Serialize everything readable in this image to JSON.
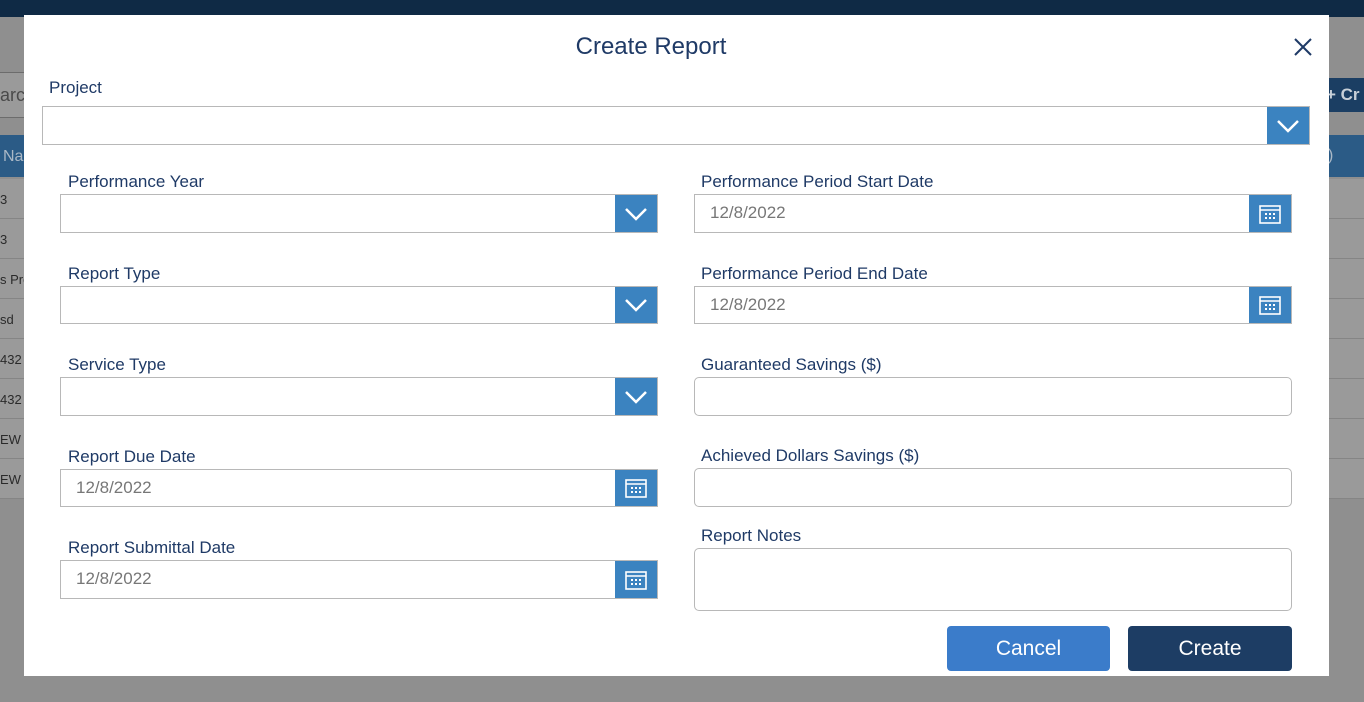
{
  "background": {
    "search_fragment": "arch",
    "create_fragment": "+ Cr",
    "header_left_fragment": "Na",
    "header_right_fragment": ")",
    "row_fragments": [
      "3",
      "3",
      "s Pro",
      "sd",
      "432",
      "432",
      "EW",
      "EW"
    ]
  },
  "modal": {
    "title": "Create Report",
    "project": {
      "label": "Project",
      "value": ""
    },
    "performance_year": {
      "label": "Performance Year",
      "value": ""
    },
    "report_type": {
      "label": "Report Type",
      "value": ""
    },
    "service_type": {
      "label": "Service Type",
      "value": ""
    },
    "report_due_date": {
      "label": "Report Due Date",
      "value": "12/8/2022"
    },
    "report_submittal_date": {
      "label": "Report Submittal Date",
      "value": "12/8/2022"
    },
    "period_start": {
      "label": "Performance Period Start Date",
      "value": "12/8/2022"
    },
    "period_end": {
      "label": "Performance Period End Date",
      "value": "12/8/2022"
    },
    "guaranteed_savings": {
      "label": "Guaranteed Savings ($)",
      "value": ""
    },
    "achieved_savings": {
      "label": "Achieved Dollars Savings ($)",
      "value": ""
    },
    "report_notes": {
      "label": "Report Notes",
      "value": ""
    },
    "cancel_label": "Cancel",
    "create_label": "Create"
  },
  "colors": {
    "accent": "#3b83c0",
    "title": "#1f3a66",
    "create_button": "#1d3d64",
    "cancel_button": "#3b7cca"
  },
  "icons": [
    "close-icon",
    "chevron-down-icon",
    "calendar-icon"
  ]
}
